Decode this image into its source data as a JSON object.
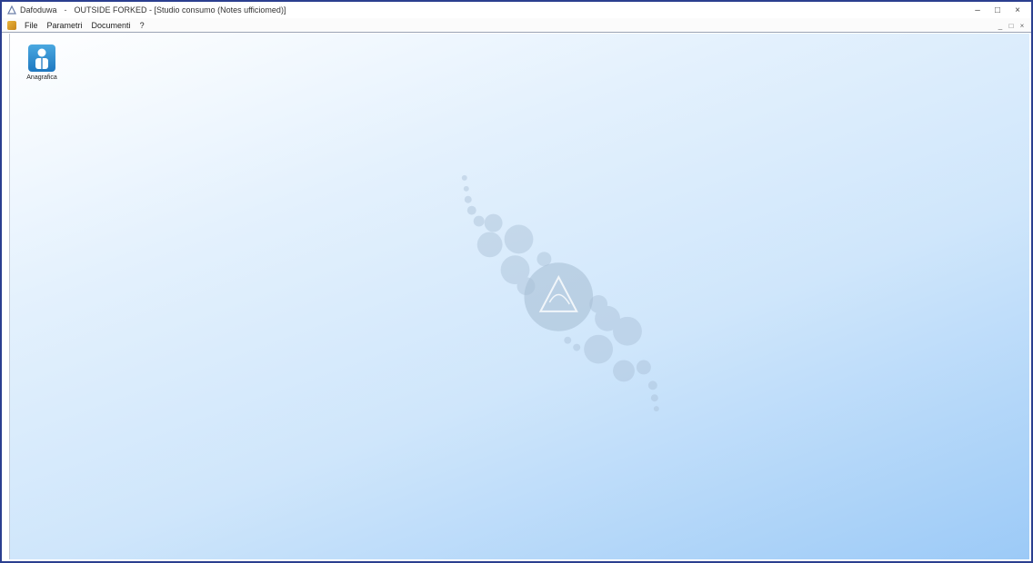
{
  "window": {
    "app_name": "Dafoduwa",
    "title": "OUTSIDE FORKED - [Studio consumo (Notes ufficiomed)]",
    "controls": {
      "minimize": "–",
      "maximize": "□",
      "close": "×"
    }
  },
  "menu": {
    "items": [
      "File",
      "Parametri",
      "Documenti",
      "?"
    ],
    "mdi_controls": [
      "_",
      "□",
      "×"
    ]
  },
  "desktop": {
    "icon_label": "Anagrafica",
    "icon_name": "person-icon"
  },
  "colors": {
    "frame": "#2b3f8f",
    "gradient_light": "#ffffff",
    "gradient_dark": "#9ccaf7",
    "watermark": "#a9bfd6"
  }
}
